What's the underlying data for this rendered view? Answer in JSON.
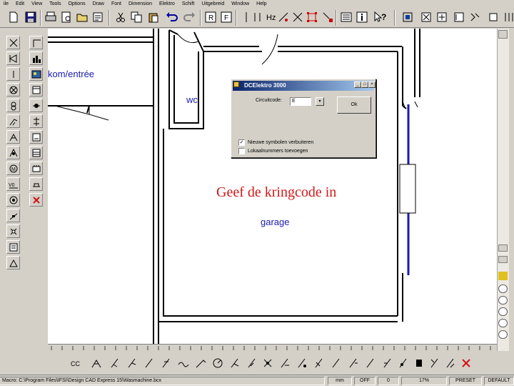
{
  "menubar": {
    "items": [
      "ile",
      "Edit",
      "View",
      "Tools",
      "Options",
      "Draw",
      "Font",
      "Dimension",
      "Elektro",
      "Schift",
      "Uitgebreid",
      "Window",
      "Help"
    ]
  },
  "drawing": {
    "rooms": {
      "kom": "kom/entrée",
      "wc": "wc",
      "garage": "garage"
    },
    "overlay_text": "Geef de kringcode in"
  },
  "dialog": {
    "title": "DCElektro 3000",
    "controls": {
      "minimize": "_",
      "maximize": "□",
      "close": "×"
    },
    "circuit_label": "Circuitcode:",
    "circuit_value": "E",
    "spin": "▾",
    "ok_label": "Ok",
    "option1": {
      "label": "Nieuwe symbolen verbuiteren",
      "checked": true,
      "mark": "✓"
    },
    "option2": {
      "label": "Lokaalnummers toevoegen",
      "checked": false,
      "mark": ""
    }
  },
  "statusbar": {
    "path": "Macro: C:\\Program Files\\IFSI\\Design CAD Express 15\\Wasmachine.bcx",
    "units": "mm",
    "snap": "OFF",
    "angle": "0",
    "zoom": "17%",
    "preset": "PRESET",
    "layer": "DEFAULT"
  },
  "colors": {
    "wall": "#000000",
    "conductor": "#1a1ab0",
    "room_text": "#1a1ab0",
    "hint_text": "#d01818",
    "chrome": "#d4d0c8"
  }
}
